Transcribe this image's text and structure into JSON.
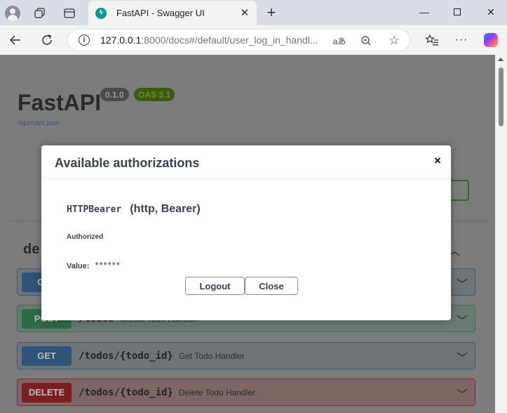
{
  "browser": {
    "tab_title": "FastAPI - Swagger UI",
    "tab_favicon": "fastapi-icon",
    "url_host": "127.0.0.1",
    "url_rest": ":8000/docs#/default/user_log_in_handl...",
    "read_aloud_glyph": "aあ"
  },
  "page": {
    "api_title": "FastAPI",
    "version": "0.1.0",
    "oas": "OAS 3.1",
    "openapi_link": "/openapi.json",
    "section_title": "de",
    "operations": [
      {
        "method": "GET",
        "path": "",
        "summary": ""
      },
      {
        "method": "POST",
        "path": "/todos",
        "summary": "Create Todo Handler"
      },
      {
        "method": "GET",
        "path": "/todos/{todo_id}",
        "summary": "Get Todo Handler"
      },
      {
        "method": "DELETE",
        "path": "/todos/{todo_id}",
        "summary": "Delete Todo Handler"
      }
    ]
  },
  "modal": {
    "title": "Available authorizations",
    "close_glyph": "×",
    "scheme_name": "HTTPBearer",
    "scheme_type": "(http, Bearer)",
    "status": "Authorized",
    "value_label": "Value:",
    "value_masked": "******",
    "logout_label": "Logout",
    "close_label": "Close"
  },
  "colors": {
    "modal_text": "#3b4151",
    "get": "#61affe",
    "post": "#49cc90",
    "delete": "#f93e3e"
  }
}
